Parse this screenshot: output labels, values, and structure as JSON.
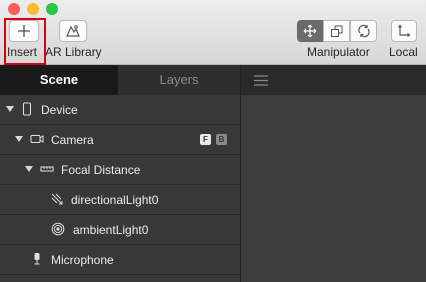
{
  "toolbar": {
    "insert_label": "Insert",
    "ar_library_label": "AR Library",
    "manipulator_label": "Manipulator",
    "local_label": "Local"
  },
  "tabs": {
    "scene": "Scene",
    "layers": "Layers"
  },
  "tree": {
    "items": [
      {
        "label": "Device",
        "icon": "phone-icon"
      },
      {
        "label": "Camera",
        "icon": "camera-icon",
        "badges": [
          "F",
          "B"
        ]
      },
      {
        "label": "Focal Distance",
        "icon": "focal-distance-icon"
      },
      {
        "label": "directionalLight0",
        "icon": "directional-light-icon"
      },
      {
        "label": "ambientLight0",
        "icon": "ambient-light-icon"
      },
      {
        "label": "Microphone",
        "icon": "microphone-icon"
      }
    ]
  },
  "colors": {
    "highlight": "#d0021b",
    "close": "#fc5f57",
    "minimize": "#fdbc2e",
    "zoom": "#28c840"
  }
}
